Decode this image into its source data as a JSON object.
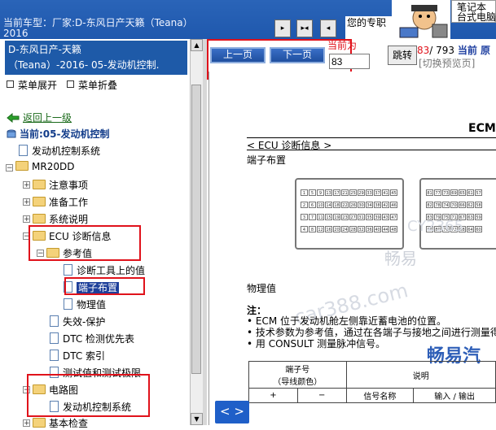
{
  "topbar": {
    "car_label_line1": "当前车型：厂家:D-东风日产天籁（Teana）",
    "car_label_line2": "2016",
    "buttons": [
      "▸",
      "▸◂",
      "◂"
    ],
    "pro_text": "您的专职",
    "ad_line1": "笔记本",
    "ad_line2": "台式电脑"
  },
  "sidebar": {
    "doc_title_line1": "D-东风日产-天籁",
    "doc_title_line2": "（Teana）-2016- 05-发动机控制.",
    "expand_label": "菜单展开",
    "collapse_label": "菜单折叠",
    "back_label": "返回上一级",
    "current_label": "当前:05-发动机控制",
    "tree": [
      {
        "label": "发动机控制系统",
        "type": "page",
        "level": 1
      },
      {
        "label": "MR20DD",
        "type": "folder",
        "level": 0
      },
      {
        "label": "注意事项",
        "type": "folder",
        "level": 1
      },
      {
        "label": "准备工作",
        "type": "folder",
        "level": 1
      },
      {
        "label": "系统说明",
        "type": "folder",
        "level": 1
      },
      {
        "label": "ECU 诊断信息",
        "type": "folder",
        "level": 1
      },
      {
        "label": "参考值",
        "type": "folder",
        "level": 2
      },
      {
        "label": "诊断工具上的值",
        "type": "page",
        "level": 3
      },
      {
        "label": "端子布置",
        "type": "page",
        "level": 3,
        "selected": true
      },
      {
        "label": "物理值",
        "type": "page",
        "level": 3
      },
      {
        "label": "失效-保护",
        "type": "page",
        "level": 2
      },
      {
        "label": "DTC 检测优先表",
        "type": "page",
        "level": 2
      },
      {
        "label": "DTC 索引",
        "type": "page",
        "level": 2
      },
      {
        "label": "测试值和测试极限",
        "type": "page",
        "level": 2
      },
      {
        "label": "电路图",
        "type": "folder",
        "level": 1
      },
      {
        "label": "发动机控制系统",
        "type": "page",
        "level": 2
      },
      {
        "label": "基本检查",
        "type": "folder",
        "level": 1
      }
    ]
  },
  "toolbar": {
    "prev_label": "上一页",
    "next_label": "下一页",
    "current_page_label": "当前为",
    "page_value": "83",
    "jump_label": "跳转",
    "page_count_current": "83",
    "page_count_total": "/ 793",
    "page_count_suffix": "当前 原",
    "preview_label": "[切换预览页]"
  },
  "document": {
    "header_code": "ECM",
    "section_title": "< ECU 诊断信息 >",
    "terminal_heading": "端子布置",
    "physical_heading": "物理值",
    "note_title": "注：",
    "notes": [
      "• ECM 位于发动机舱左侧靠近蓄电池的位置。",
      "• 技术参数为参考值，通过在各端子与接地之间进行测量得",
      "• 用 CONSULT 测量脉冲信号。"
    ],
    "connector_pins_left": [
      [
        "1",
        "5",
        "9",
        "13",
        "17",
        "21",
        "25",
        "29",
        "33",
        "37",
        "41",
        "45"
      ],
      [
        "2",
        "6",
        "10",
        "14",
        "18",
        "22",
        "26",
        "30",
        "34",
        "38",
        "42",
        "46"
      ],
      [
        "3",
        "7",
        "11",
        "15",
        "19",
        "23",
        "27",
        "31",
        "35",
        "39",
        "43",
        "47"
      ],
      [
        "4",
        "8",
        "12",
        "16",
        "20",
        "24",
        "28",
        "32",
        "36",
        "40",
        "44",
        "48"
      ]
    ],
    "connector_pins_right": [
      [
        "81",
        "77",
        "73",
        "69",
        "65",
        "61",
        "57"
      ],
      [
        "82",
        "78",
        "74",
        "70",
        "66",
        "62",
        "58"
      ],
      [
        "83",
        "79",
        "75",
        "71",
        "67",
        "63",
        "59"
      ],
      [
        "84",
        "80",
        "76",
        "72",
        "68",
        "64",
        "60"
      ]
    ],
    "table": {
      "col1_header": "端子号",
      "col1_sub": "（导线颜色）",
      "col2_header": "说明",
      "plus": "+",
      "minus": "−",
      "signal_name": "信号名称",
      "io_header": "输入 / 输出"
    },
    "watermarks": [
      "畅易",
      "car388.com",
      "CY2365"
    ],
    "brand": "畅易汽"
  },
  "pager_button": "< >"
}
